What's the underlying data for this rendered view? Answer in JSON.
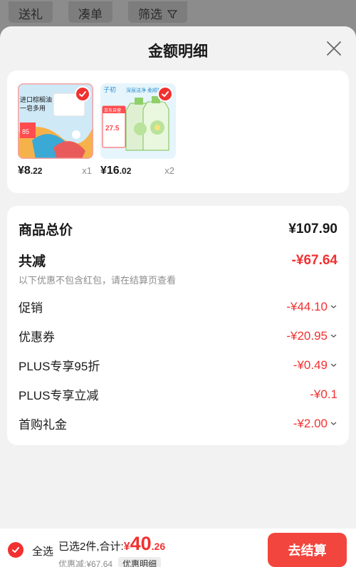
{
  "background_tabs": [
    "送礼",
    "凑单",
    "筛选"
  ],
  "filter_icon": "funnel-icon",
  "sheet": {
    "title": "金额明细",
    "close_icon": "close-icon"
  },
  "products": [
    {
      "price_int": "¥8",
      "price_dec": ".22",
      "qty": "x1",
      "selected": true,
      "image_text": [
        "进口棕榈油",
        "一皂多用",
        "85"
      ]
    },
    {
      "price_int": "¥16",
      "price_dec": ".02",
      "qty": "x2",
      "selected": true,
      "image_text": [
        "子初",
        "深层洁净 柔顺护衣",
        "京东自营",
        "27.5"
      ]
    }
  ],
  "summary": {
    "total_label": "商品总价",
    "total_value": "¥107.90",
    "reduce_label": "共减",
    "reduce_value": "-¥67.64",
    "reduce_note": "以下优惠不包含红包，请在结算页查看",
    "items": [
      {
        "label": "促销",
        "value": "-¥44.10",
        "expandable": true
      },
      {
        "label": "优惠券",
        "value": "-¥20.95",
        "expandable": true
      },
      {
        "label": "PLUS专享95折",
        "value": "-¥0.49",
        "expandable": true
      },
      {
        "label": "PLUS专享立减",
        "value": "-¥0.1",
        "expandable": false
      },
      {
        "label": "首购礼金",
        "value": "-¥2.00",
        "expandable": true
      }
    ]
  },
  "bottom_bar": {
    "select_all_label": "全选",
    "selected_text": "已选2件,合计:",
    "total_symbol": "¥",
    "total_int": "40",
    "total_dec": ".26",
    "discount_text": "优惠减:¥67.64",
    "detail_label": "优惠明细",
    "checkout_label": "去结算"
  },
  "colors": {
    "accent": "#f23030",
    "button": "#f2453d",
    "text": "#1a1a1a",
    "muted": "#8c8c8c"
  }
}
